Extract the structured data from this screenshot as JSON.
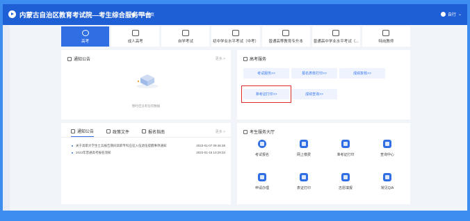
{
  "header": {
    "title": "内蒙古自治区教育考试院—考生综合服务平台",
    "home_label": "平台主页",
    "user_label": "自行"
  },
  "nav": [
    {
      "label": "高考",
      "icon": "exam-cap-icon",
      "active": true
    },
    {
      "label": "成人高考",
      "icon": "pen-icon",
      "active": false
    },
    {
      "label": "自学考试",
      "icon": "book-icon",
      "active": false
    },
    {
      "label": "初中学业水平考试（中考）",
      "icon": "edit-doc-icon",
      "active": false
    },
    {
      "label": "普通高等教育专升本",
      "icon": "document-icon",
      "active": false
    },
    {
      "label": "普通高中学业水平考试（...",
      "icon": "edit-icon",
      "active": false
    },
    {
      "label": "特岗教师",
      "icon": "graduation-icon",
      "active": false
    }
  ],
  "notice_panel": {
    "title": "通知公告",
    "more": "更多 >",
    "empty_text": "暂时还没有任何数据"
  },
  "exam_panel": {
    "title": "高考服务",
    "buttons": [
      "考试服务>>",
      "报名表核打印>>",
      "成绩复核>>",
      "准考证打印>>",
      "成绩查询>>"
    ]
  },
  "news_panel": {
    "tabs": [
      "通知公告",
      "政策文件",
      "报名指南"
    ],
    "more": "更多 >",
    "items": [
      {
        "text": "关于高职大学生士兵报告期间高职专科应征入伍退伍提醒事项通知",
        "date": "2023-01-07 09:45:38"
      },
      {
        "text": "2023年普通高考报名须知",
        "date": "2022-01-15 13:29:33"
      }
    ]
  },
  "service_panel": {
    "title": "考生服务大厅",
    "items": [
      "考试报名",
      "网上缴费",
      "准考证打印",
      "查询中心",
      "申请办理",
      "表证打印",
      "志愿填报",
      "常见Q/A"
    ]
  }
}
